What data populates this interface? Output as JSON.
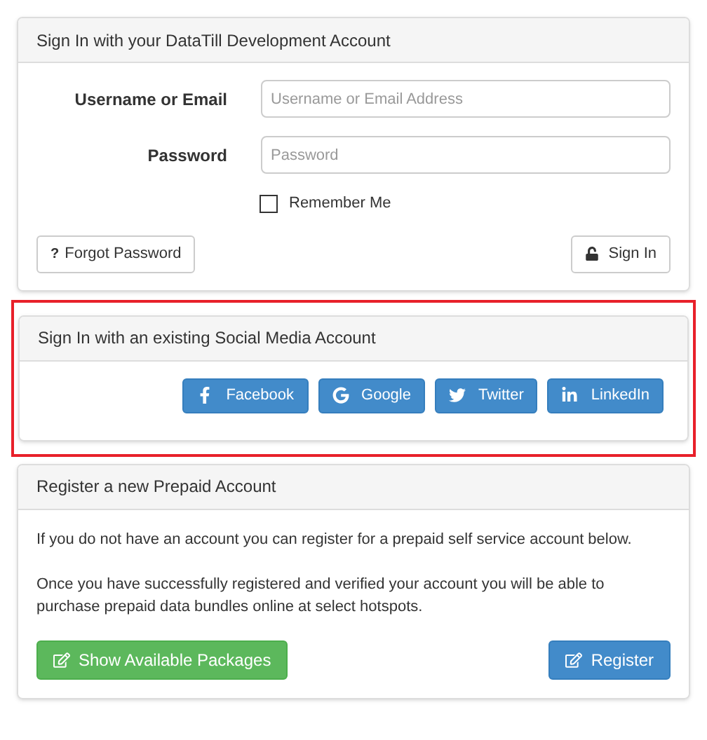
{
  "login_panel": {
    "title": "Sign In with your DataTill Development Account",
    "fields": [
      {
        "label": "Username or Email",
        "placeholder": "Username or Email Address"
      },
      {
        "label": "Password",
        "placeholder": "Password"
      }
    ],
    "remember": {
      "label": "Remember Me",
      "checked": false
    },
    "forgot_button": {
      "icon": "?",
      "label": "Forgot Password"
    },
    "sign_in_button": {
      "label": "Sign In"
    }
  },
  "social_panel": {
    "title": "Sign In with an existing Social Media Account",
    "highlighted": true,
    "buttons": [
      {
        "kind": "facebook",
        "label": "Facebook"
      },
      {
        "kind": "google",
        "label": "Google"
      },
      {
        "kind": "twitter",
        "label": "Twitter"
      },
      {
        "kind": "linkedin",
        "label": "LinkedIn"
      }
    ]
  },
  "register_panel": {
    "title": "Register a new Prepaid Account",
    "paragraphs": [
      "If you do not have an account you can register for a prepaid self service account below.",
      "Once you have successfully registered and verified your account you will be able to purchase prepaid data bundles online at select hotspots."
    ],
    "packages_button": {
      "label": "Show Available Packages"
    },
    "register_button": {
      "label": "Register"
    }
  }
}
